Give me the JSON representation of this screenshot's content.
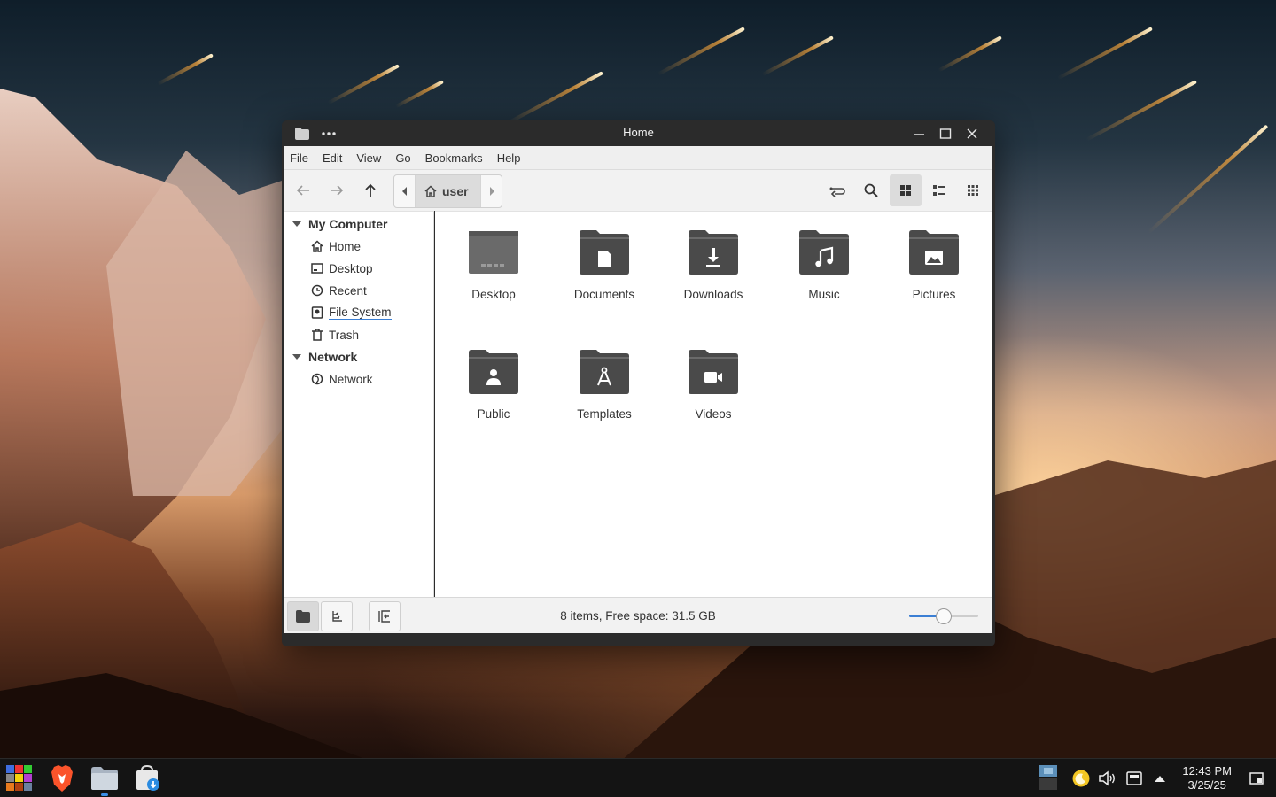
{
  "window": {
    "title": "Home",
    "icons": [
      "folder-icon",
      "more-icon",
      "minimize-icon",
      "maximize-icon",
      "close-icon"
    ]
  },
  "menu": [
    "File",
    "Edit",
    "View",
    "Go",
    "Bookmarks",
    "Help"
  ],
  "toolbar": {
    "breadcrumb": "user",
    "icons": [
      "back-icon",
      "forward-icon",
      "up-icon",
      "toggle-location-icon",
      "search-icon",
      "icon-view-icon",
      "list-view-icon",
      "compact-view-icon"
    ]
  },
  "sidebar": {
    "sections": [
      {
        "title": "My Computer",
        "items": [
          {
            "label": "Home",
            "icon": "home-icon"
          },
          {
            "label": "Desktop",
            "icon": "desktop-icon"
          },
          {
            "label": "Recent",
            "icon": "recent-icon"
          },
          {
            "label": "File System",
            "icon": "drive-icon"
          },
          {
            "label": "Trash",
            "icon": "trash-icon"
          }
        ]
      },
      {
        "title": "Network",
        "items": [
          {
            "label": "Network",
            "icon": "network-icon"
          }
        ]
      }
    ]
  },
  "files": [
    {
      "name": "Desktop",
      "icon": "desktop-folder-icon"
    },
    {
      "name": "Documents",
      "icon": "documents-folder-icon"
    },
    {
      "name": "Downloads",
      "icon": "downloads-folder-icon"
    },
    {
      "name": "Music",
      "icon": "music-folder-icon"
    },
    {
      "name": "Pictures",
      "icon": "pictures-folder-icon"
    },
    {
      "name": "Public",
      "icon": "public-folder-icon"
    },
    {
      "name": "Templates",
      "icon": "templates-folder-icon"
    },
    {
      "name": "Videos",
      "icon": "videos-folder-icon"
    }
  ],
  "statusbar": {
    "text": "8 items, Free space: 31.5 GB",
    "zoom_fraction": 0.5
  },
  "taskbar": {
    "time": "12:43 PM",
    "date": "3/25/25",
    "apps": [
      "app-menu-icon",
      "brave-browser-icon",
      "file-manager-icon",
      "software-store-icon"
    ],
    "tray": [
      "workspace-icon",
      "night-light-icon",
      "volume-icon",
      "network-status-icon",
      "tray-expand-icon",
      "show-desktop-icon"
    ]
  },
  "colors": {
    "accent": "#3b7fd4",
    "folder": "#4a4a4a",
    "titlebar": "#2b2b2b"
  }
}
